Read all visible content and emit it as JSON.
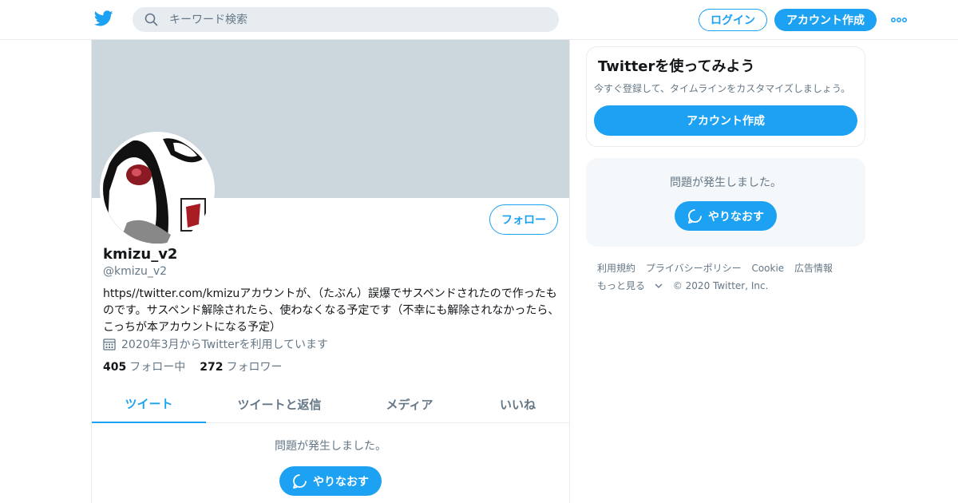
{
  "header": {
    "search_placeholder": "キーワード検索",
    "login_label": "ログイン",
    "signup_label": "アカウント作成",
    "accent_color": "#1da1f2"
  },
  "profile": {
    "display_name": "kmizu_v2",
    "handle": "@kmizu_v2",
    "follow_label": "フォロー",
    "bio": "https//twitter.com/kmizuアカウントが、（たぶん）誤爆でサスペンドされたので作ったものです。サスペンド解除されたら、使わなくなる予定です（不幸にも解除されなかったら、こっちが本アカウントになる予定）",
    "joined": "2020年3月からTwitterを利用しています",
    "following_count": "405",
    "following_label": "フォロー中",
    "followers_count": "272",
    "followers_label": "フォロワー"
  },
  "tabs": [
    {
      "label": "ツイート",
      "active": true
    },
    {
      "label": "ツイートと返信",
      "active": false
    },
    {
      "label": "メディア",
      "active": false
    },
    {
      "label": "いいね",
      "active": false
    }
  ],
  "timeline": {
    "error_text": "問題が発生しました。",
    "retry_label": "やりなおす"
  },
  "sidebar": {
    "signup_card": {
      "title": "Twitterを使ってみよう",
      "subtitle": "今すぐ登録して、タイムラインをカスタマイズしましょう。",
      "button_label": "アカウント作成"
    },
    "error_card": {
      "error_text": "問題が発生しました。",
      "retry_label": "やりなおす"
    },
    "footer": {
      "links": [
        "利用規約",
        "プライバシーポリシー",
        "Cookie",
        "広告情報"
      ],
      "more_label": "もっと見る",
      "copyright": "© 2020 Twitter, Inc."
    }
  }
}
